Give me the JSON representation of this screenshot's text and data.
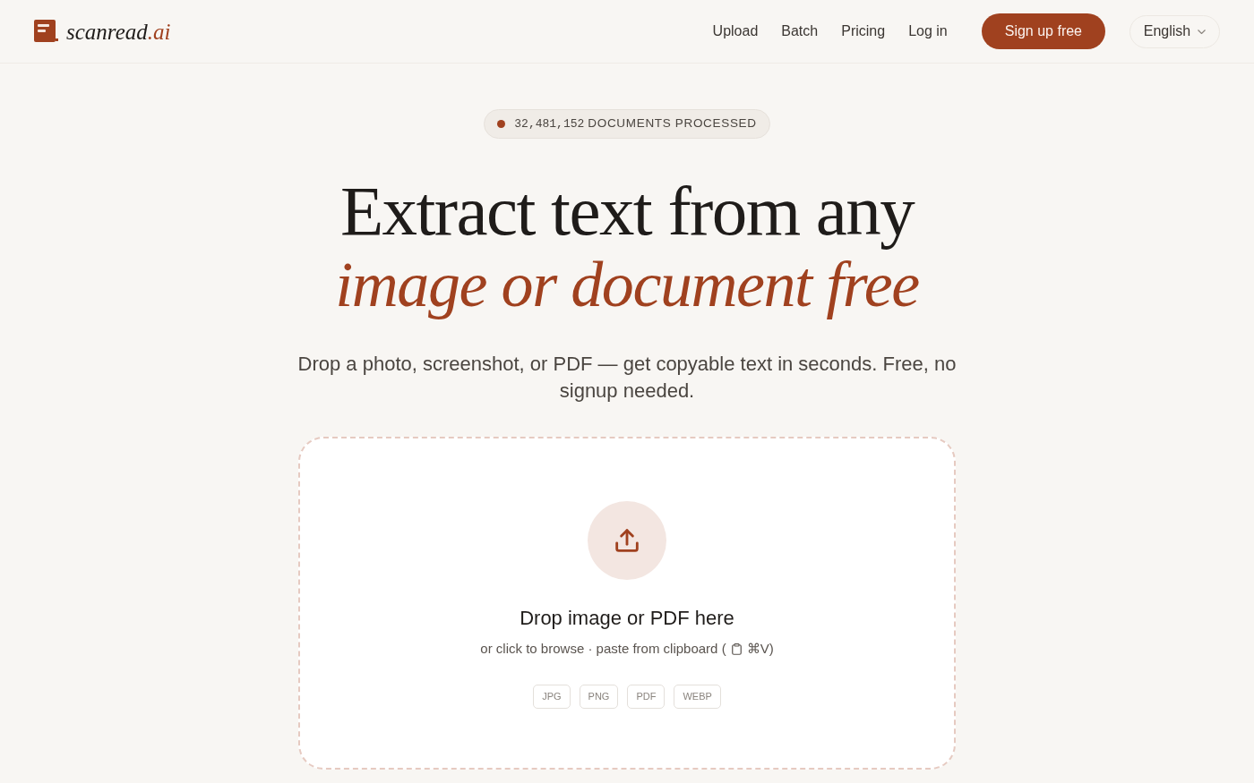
{
  "header": {
    "brand": {
      "name": "scanread",
      "suffix": ".ai"
    },
    "nav": [
      {
        "label": "Upload",
        "kind": "link"
      },
      {
        "label": "Batch",
        "kind": "link"
      },
      {
        "label": "Pricing",
        "kind": "link"
      },
      {
        "label": "Log in",
        "kind": "link"
      },
      {
        "label": "Sign up free",
        "kind": "primary"
      }
    ],
    "language": {
      "value": "English"
    }
  },
  "hero": {
    "badge": {
      "count": "32,481,152",
      "label": "DOCUMENTS PROCESSED"
    },
    "headline": "Extract text from any",
    "headline_accent": "image or document free",
    "subtitle": "Drop a photo, screenshot, or PDF — get copyable text in seconds. Free, no signup needed."
  },
  "dropzone": {
    "title": "Drop image or PDF here",
    "hint": "or click to browse · paste from clipboard (",
    "shortcut": "⌘V)",
    "formats": [
      "JPG",
      "PNG",
      "PDF",
      "WEBP"
    ]
  }
}
